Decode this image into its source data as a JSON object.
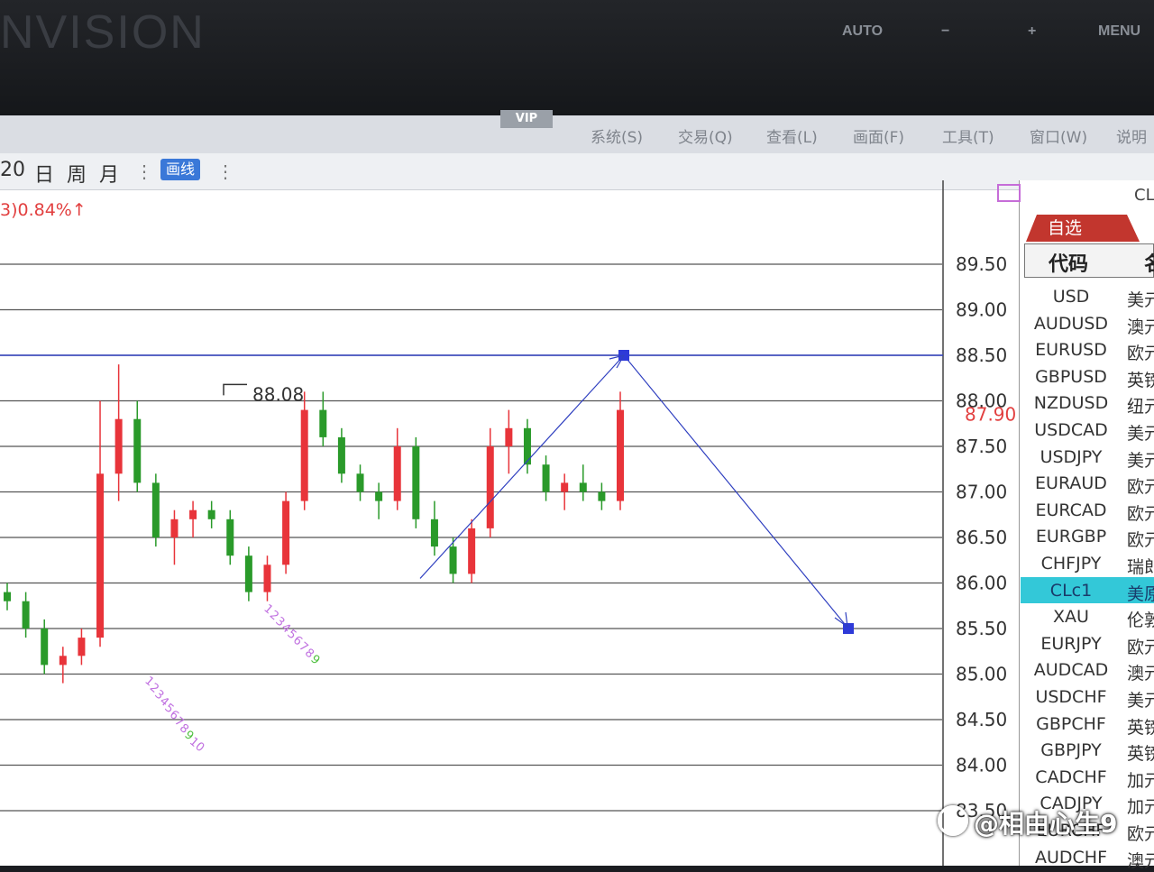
{
  "bezel": {
    "brand": "NVISION",
    "auto": "AUTO",
    "minus": "−",
    "plus": "+",
    "menu": "MENU"
  },
  "menubar": {
    "vip": "VIP",
    "items": [
      "系统(S)",
      "交易(Q)",
      "查看(L)",
      "画面(F)",
      "工具(T)",
      "窗口(W)",
      "说明"
    ]
  },
  "toolbar": {
    "period_partial": "20",
    "day": "日",
    "week": "周",
    "month": "月",
    "draw": "画线"
  },
  "chart": {
    "change_text": "3)0.84%↑",
    "high_label": "88.08",
    "last_price": "87.90",
    "price_axis": [
      "89.50",
      "89.00",
      "88.50",
      "88.00",
      "87.50",
      "87.00",
      "86.50",
      "86.00",
      "85.50",
      "85.00",
      "84.50",
      "84.00",
      "83.50"
    ],
    "colors": {
      "up": "#e8343a",
      "down": "#2a9a2a",
      "line": "#3040c0",
      "handle": "#2e3ad8",
      "annot": "#c070e0",
      "annot2": "#50c040"
    },
    "annotations": [
      "1",
      "2",
      "3",
      "4",
      "5",
      "6",
      "7",
      "8",
      "9",
      "10"
    ]
  },
  "chart_data": {
    "type": "candlestick",
    "ylim": [
      83.5,
      89.9
    ],
    "horizontal_line": 88.5,
    "high_marker": 88.08,
    "last": 87.9,
    "projection": {
      "points": [
        [
          86.05
        ],
        [
          88.5
        ],
        [
          85.5
        ]
      ]
    },
    "candles": [
      [
        85.9,
        86.0,
        85.7,
        85.8
      ],
      [
        85.8,
        85.9,
        85.4,
        85.5
      ],
      [
        85.5,
        85.6,
        85.0,
        85.1
      ],
      [
        85.1,
        85.3,
        84.9,
        85.2
      ],
      [
        85.2,
        85.5,
        85.1,
        85.4
      ],
      [
        85.4,
        88.0,
        85.3,
        87.2
      ],
      [
        87.2,
        88.4,
        86.9,
        87.8
      ],
      [
        87.8,
        88.0,
        87.0,
        87.1
      ],
      [
        87.1,
        87.2,
        86.4,
        86.5
      ],
      [
        86.5,
        86.8,
        86.2,
        86.7
      ],
      [
        86.7,
        86.9,
        86.5,
        86.8
      ],
      [
        86.8,
        86.9,
        86.6,
        86.7
      ],
      [
        86.7,
        86.8,
        86.2,
        86.3
      ],
      [
        86.3,
        86.4,
        85.8,
        85.9
      ],
      [
        85.9,
        86.3,
        85.8,
        86.2
      ],
      [
        86.2,
        87.0,
        86.1,
        86.9
      ],
      [
        86.9,
        88.1,
        86.8,
        87.9
      ],
      [
        87.9,
        88.1,
        87.5,
        87.6
      ],
      [
        87.6,
        87.7,
        87.1,
        87.2
      ],
      [
        87.2,
        87.3,
        86.9,
        87.0
      ],
      [
        87.0,
        87.1,
        86.7,
        86.9
      ],
      [
        86.9,
        87.7,
        86.8,
        87.5
      ],
      [
        87.5,
        87.6,
        86.6,
        86.7
      ],
      [
        86.7,
        86.9,
        86.3,
        86.4
      ],
      [
        86.4,
        86.5,
        86.0,
        86.1
      ],
      [
        86.1,
        86.7,
        86.0,
        86.6
      ],
      [
        86.6,
        87.7,
        86.5,
        87.5
      ],
      [
        87.5,
        87.9,
        87.2,
        87.7
      ],
      [
        87.7,
        87.8,
        87.2,
        87.3
      ],
      [
        87.3,
        87.4,
        86.9,
        87.0
      ],
      [
        87.0,
        87.2,
        86.8,
        87.1
      ],
      [
        87.1,
        87.3,
        86.9,
        87.0
      ],
      [
        87.0,
        87.1,
        86.8,
        86.9
      ],
      [
        86.9,
        88.1,
        86.8,
        87.9
      ]
    ]
  },
  "panel": {
    "title_partial": "CL",
    "tab": "自选",
    "col_code": "代码",
    "col_name": "名",
    "rows": [
      {
        "code": "USD",
        "name": "美元"
      },
      {
        "code": "AUDUSD",
        "name": "澳元"
      },
      {
        "code": "EURUSD",
        "name": "欧元"
      },
      {
        "code": "GBPUSD",
        "name": "英镑"
      },
      {
        "code": "NZDUSD",
        "name": "纽元"
      },
      {
        "code": "USDCAD",
        "name": "美元"
      },
      {
        "code": "USDJPY",
        "name": "美元"
      },
      {
        "code": "EURAUD",
        "name": "欧元"
      },
      {
        "code": "EURCAD",
        "name": "欧元"
      },
      {
        "code": "EURGBP",
        "name": "欧元"
      },
      {
        "code": "CHFJPY",
        "name": "瑞郎"
      },
      {
        "code": "CLc1",
        "name": "美原油"
      },
      {
        "code": "XAU",
        "name": "伦敦"
      },
      {
        "code": "EURJPY",
        "name": "欧元"
      },
      {
        "code": "AUDCAD",
        "name": "澳元"
      },
      {
        "code": "USDCHF",
        "name": "美元"
      },
      {
        "code": "GBPCHF",
        "name": "英镑"
      },
      {
        "code": "GBPJPY",
        "name": "英镑"
      },
      {
        "code": "CADCHF",
        "name": "加元"
      },
      {
        "code": "CADJPY",
        "name": "加元"
      },
      {
        "code": "EURCHF",
        "name": "欧元"
      },
      {
        "code": "AUDCHF",
        "name": "澳元"
      }
    ]
  },
  "watermark": "@相由心生9"
}
